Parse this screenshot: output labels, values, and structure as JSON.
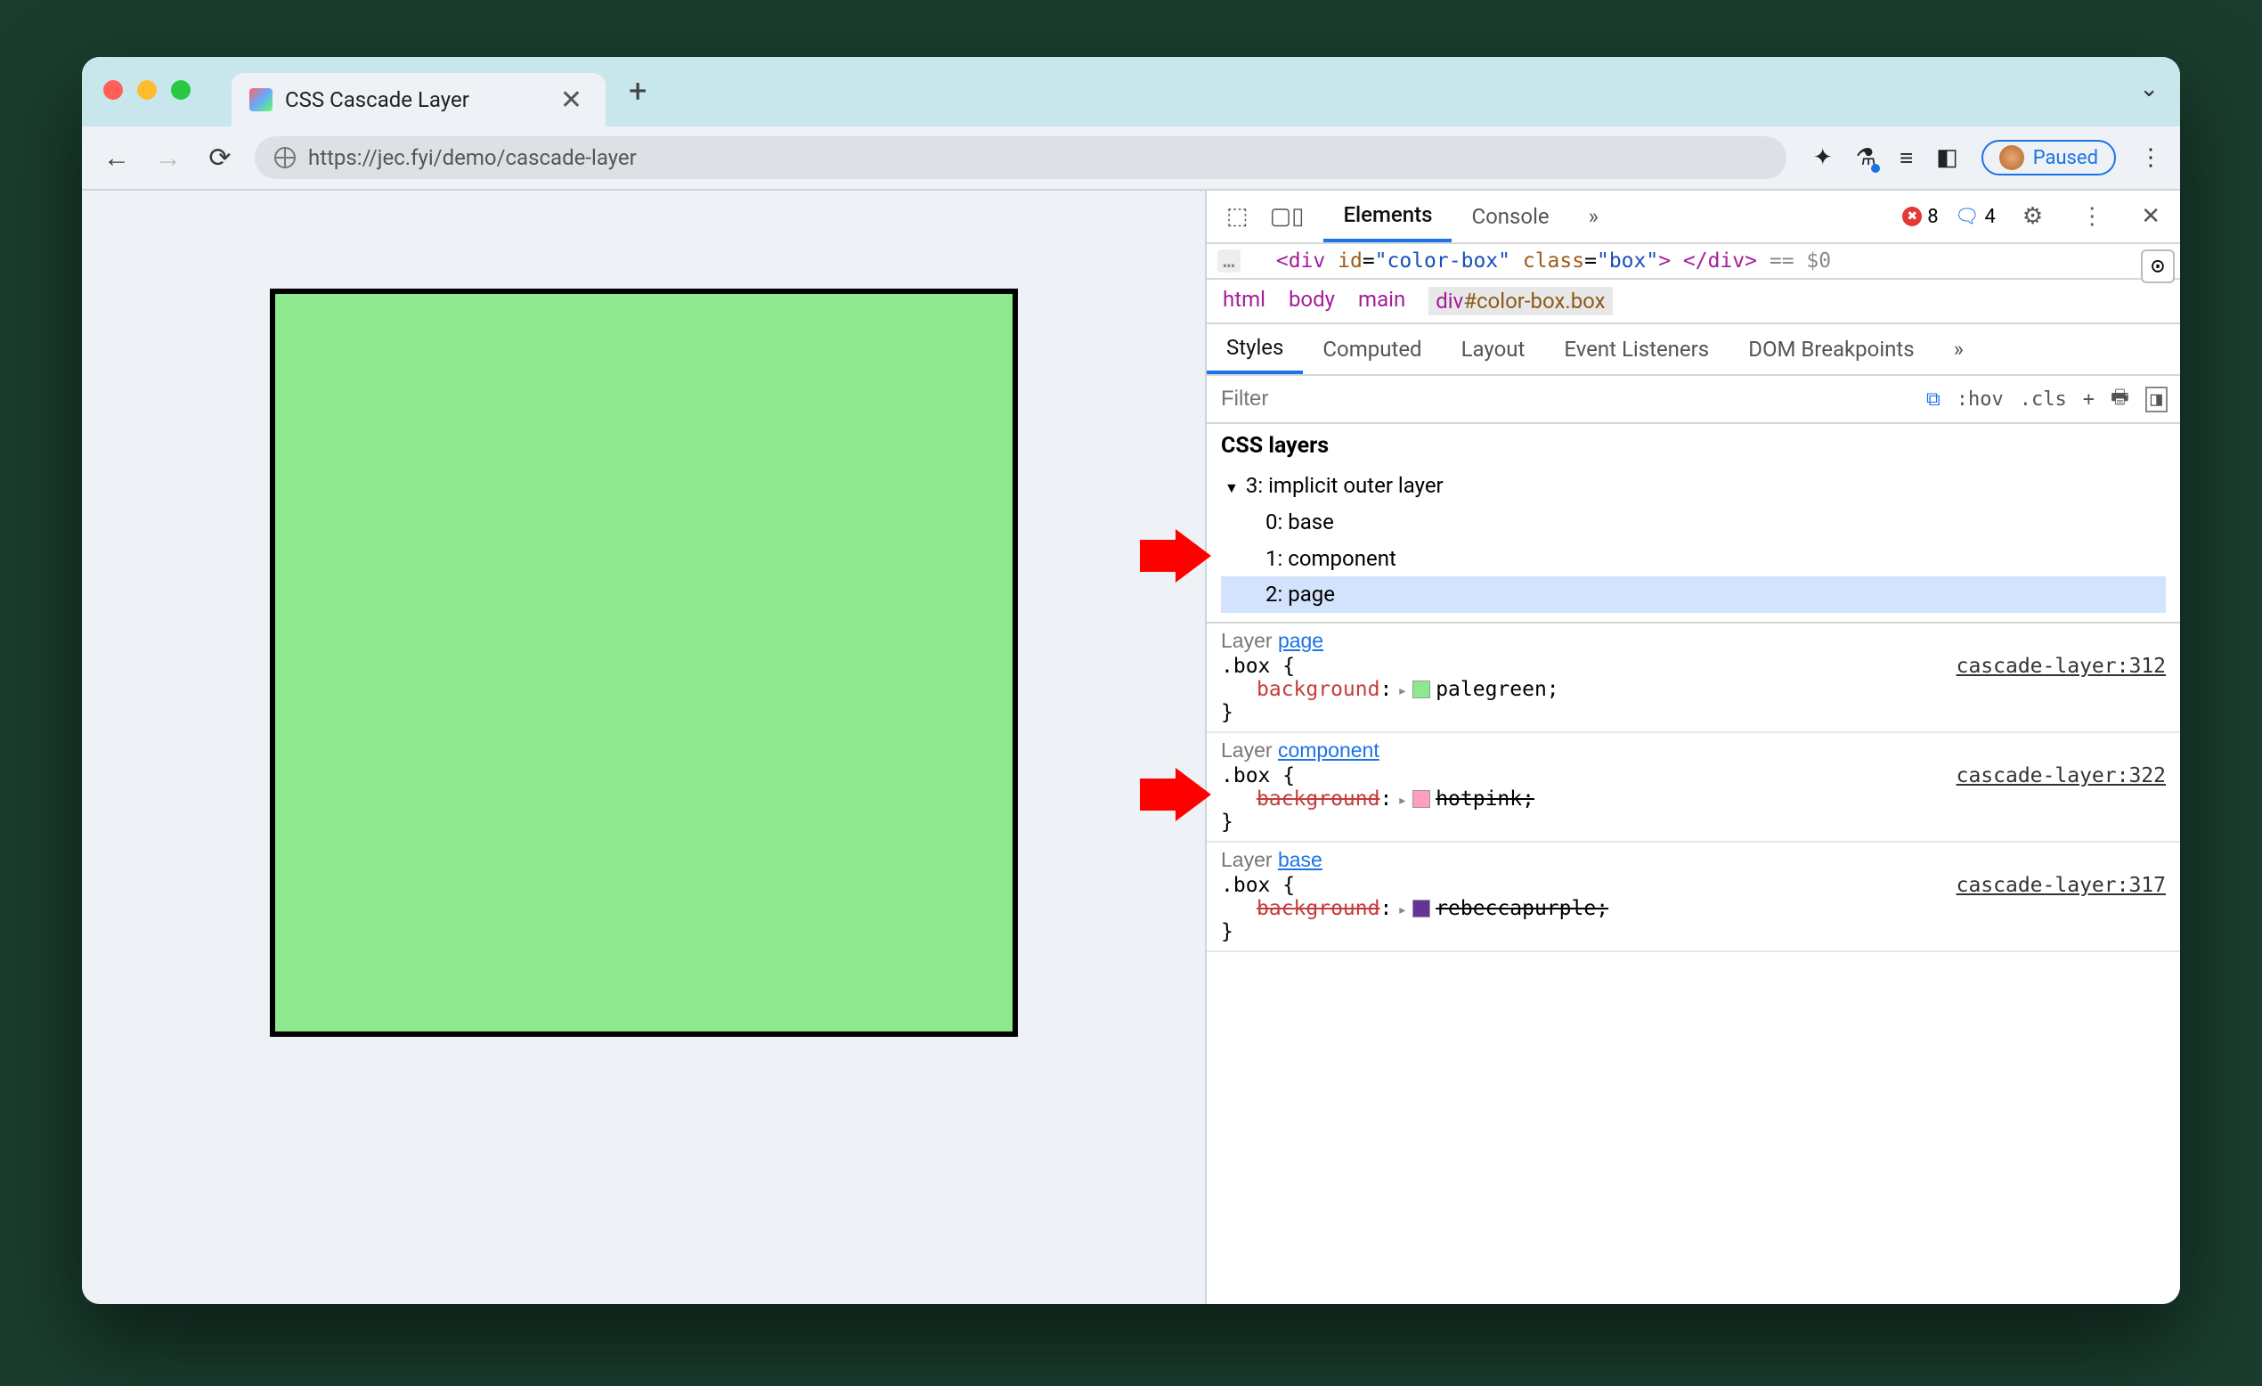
{
  "tab": {
    "title": "CSS Cascade Layer"
  },
  "addr": {
    "url": "https://jec.fyi/demo/cascade-layer"
  },
  "paused_label": "Paused",
  "devtools": {
    "main_tabs": [
      "Elements",
      "Console"
    ],
    "active_main_tab": "Elements",
    "err_count": "8",
    "info_count": "4",
    "dom_snippet": {
      "open": "<div",
      "id_attr": "id",
      "id_val": "\"color-box\"",
      "class_attr": "class",
      "class_val": "\"box\"",
      "close": "> </div>",
      "eq": "== $0"
    },
    "breadcrumb": [
      "html",
      "body",
      "main"
    ],
    "breadcrumb_selected": "div#color-box.box",
    "styles_tabs": [
      "Styles",
      "Computed",
      "Layout",
      "Event Listeners",
      "DOM Breakpoints"
    ],
    "active_styles_tab": "Styles",
    "filter_placeholder": "Filter",
    "filter_actions": [
      ":hov",
      ".cls",
      "+"
    ],
    "layers_heading": "CSS layers",
    "layers_root": "3: implicit outer layer",
    "layers_children": [
      "0: base",
      "1: component",
      "2: page"
    ],
    "rules": [
      {
        "layer_label": "Layer ",
        "layer_link": "page",
        "selector": ".box {",
        "source": "cascade-layer:312",
        "prop_name": "background",
        "prop_value": "palegreen;",
        "swatch": "#8ee98e",
        "overridden": false,
        "close": "}"
      },
      {
        "layer_label": "Layer ",
        "layer_link": "component",
        "selector": ".box {",
        "source": "cascade-layer:322",
        "prop_name": "background",
        "prop_value": "hotpink;",
        "swatch": "#ff9ec0",
        "overridden": true,
        "close": "}"
      },
      {
        "layer_label": "Layer ",
        "layer_link": "base",
        "selector": ".box {",
        "source": "cascade-layer:317",
        "prop_name": "background",
        "prop_value": "rebeccapurple;",
        "swatch": "#663399",
        "overridden": true,
        "close": "}"
      }
    ]
  }
}
